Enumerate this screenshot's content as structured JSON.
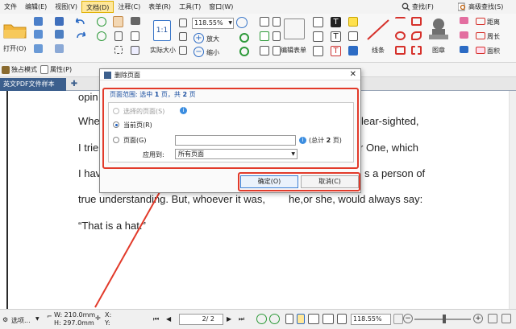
{
  "menubar": {
    "items": [
      "文件",
      "编辑(E)",
      "视图(V)",
      "文档(D)",
      "注释(C)",
      "表单(R)",
      "工具(T)",
      "窗口(W)"
    ],
    "active_index": 3,
    "find_label": "查找(F)",
    "advanced_find_label": "高级查找(S)"
  },
  "ribbon": {
    "open_label": "打开(O)",
    "actual_size_label": "实际大小",
    "zoom_value": "118.55%",
    "zoom_in_label": "放大",
    "zoom_out_label": "缩小",
    "edit_form_label": "编辑表单",
    "lines_label": "线条",
    "stamp_label": "图章",
    "distance_label": "距离",
    "perimeter_label": "周长",
    "area_label": "面积"
  },
  "toolbar2": {
    "exclusive_mode_label": "独占模式",
    "properties_label": "属性(P)"
  },
  "tabs": {
    "doc_tab_label": "英文PDF文件样本"
  },
  "document": {
    "lines": [
      "opin",
      "Whe",
      "lear-sighted,",
      "I trie",
      "r One, which",
      "I hav",
      "s a person of",
      "true understanding. But, whoever it was,",
      "he,or she, would always say:",
      "“That is a hat.”"
    ]
  },
  "dialog": {
    "title": "删除页面",
    "range_prefix": "页面范围: 选中 ",
    "range_selected": "1",
    "range_mid": " 页，共 ",
    "range_total": "2",
    "range_suffix": " 页",
    "option_selected_pages": "选择的页面(S)",
    "option_current_page": "当前页(R)",
    "option_pages": "页面(G)",
    "pages_input_value": "",
    "total_prefix": "(总计 ",
    "total_count": "2",
    "total_suffix": " 页)",
    "apply_to_label": "应用到:",
    "apply_to_value": "所有页面",
    "ok_label": "确定(O)",
    "cancel_label": "取消(C)"
  },
  "statusbar": {
    "options_label": "选项...",
    "width_label": "W: 210.0mm",
    "height_label": "H: 297.0mm",
    "x_label": "X:",
    "y_label": "Y:",
    "page_value": "2",
    "page_total": "/ 2",
    "zoom_value": "118.55%"
  },
  "colors": {
    "accent_tab": "#3c5f8d",
    "highlight": "#e23a2a",
    "menu_active": "#ffe79a"
  }
}
